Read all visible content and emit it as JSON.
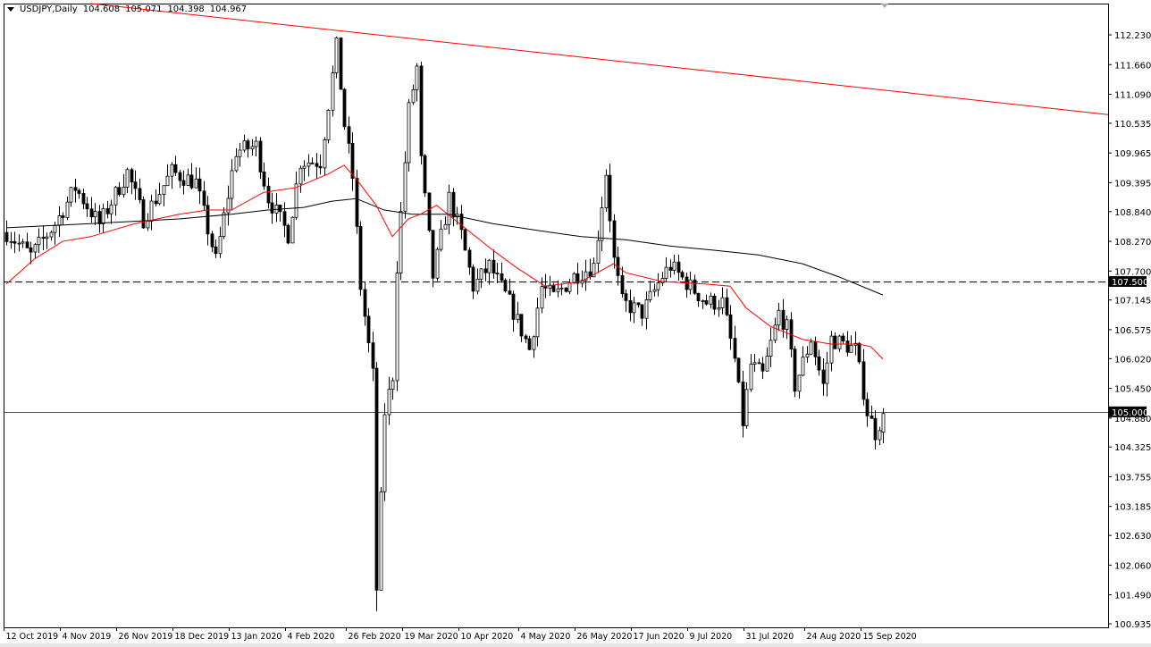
{
  "header": {
    "symbol": "USDJPY,Daily",
    "open": "104.608",
    "high": "105.071",
    "low": "104.398",
    "close": "104.967"
  },
  "chart_data": {
    "type": "candlestick",
    "title": "USDJPY,Daily",
    "ylim": [
      100.935,
      112.23
    ],
    "y_ticks": [
      "112.230",
      "111.660",
      "111.090",
      "110.535",
      "109.965",
      "109.395",
      "108.840",
      "108.270",
      "107.700",
      "107.145",
      "106.575",
      "106.020",
      "105.450",
      "104.880",
      "104.325",
      "103.755",
      "103.185",
      "102.630",
      "102.060",
      "101.490",
      "100.935"
    ],
    "x_ticks": [
      {
        "bar": 0,
        "label": "12 Oct 2019"
      },
      {
        "bar": 14,
        "label": "4 Nov 2019"
      },
      {
        "bar": 28,
        "label": "26 Nov 2019"
      },
      {
        "bar": 42,
        "label": "18 Dec 2019"
      },
      {
        "bar": 56,
        "label": "13 Jan 2020"
      },
      {
        "bar": 70,
        "label": "4 Feb 2020"
      },
      {
        "bar": 85,
        "label": "26 Feb 2020"
      },
      {
        "bar": 99,
        "label": "19 Mar 2020"
      },
      {
        "bar": 113,
        "label": "10 Apr 2020"
      },
      {
        "bar": 128,
        "label": "4 May 2020"
      },
      {
        "bar": 142,
        "label": "26 May 2020"
      },
      {
        "bar": 156,
        "label": "17 Jun 2020"
      },
      {
        "bar": 170,
        "label": "9 Jul 2020"
      },
      {
        "bar": 184,
        "label": "31 Jul 2020"
      },
      {
        "bar": 199,
        "label": "24 Aug 2020"
      },
      {
        "bar": 213,
        "label": "15 Sep 2020"
      }
    ],
    "bars_visible": 275,
    "close_path": [
      [
        0,
        108.44
      ],
      [
        6,
        108.0
      ],
      [
        12,
        108.6
      ],
      [
        17,
        109.3
      ],
      [
        23,
        108.6
      ],
      [
        30,
        109.6
      ],
      [
        34,
        108.7
      ],
      [
        41,
        109.6
      ],
      [
        47,
        109.4
      ],
      [
        52,
        107.9
      ],
      [
        57,
        110.0
      ],
      [
        62,
        110.1
      ],
      [
        65,
        109.1
      ],
      [
        70,
        108.4
      ],
      [
        73,
        109.8
      ],
      [
        78,
        109.8
      ],
      [
        82,
        112.0
      ],
      [
        84,
        110.5
      ],
      [
        86,
        109.5
      ],
      [
        88,
        107.4
      ],
      [
        91,
        105.7
      ],
      [
        92,
        101.6
      ],
      [
        94,
        105.0
      ],
      [
        96,
        105.7
      ],
      [
        97,
        107.8
      ],
      [
        100,
        110.8
      ],
      [
        102,
        111.6
      ],
      [
        103,
        109.8
      ],
      [
        106,
        107.6
      ],
      [
        110,
        109.1
      ],
      [
        113,
        108.4
      ],
      [
        116,
        107.4
      ],
      [
        120,
        107.8
      ],
      [
        125,
        107.1
      ],
      [
        130,
        106.2
      ],
      [
        133,
        107.4
      ],
      [
        136,
        107.2
      ],
      [
        141,
        107.6
      ],
      [
        146,
        107.8
      ],
      [
        149,
        109.6
      ],
      [
        151,
        107.9
      ],
      [
        153,
        107.1
      ],
      [
        158,
        106.9
      ],
      [
        163,
        107.6
      ],
      [
        165,
        107.8
      ],
      [
        170,
        107.4
      ],
      [
        174,
        107.1
      ],
      [
        178,
        107.1
      ],
      [
        181,
        106.0
      ],
      [
        183,
        104.8
      ],
      [
        185,
        105.9
      ],
      [
        188,
        105.7
      ],
      [
        192,
        106.9
      ],
      [
        194,
        106.6
      ],
      [
        196,
        105.5
      ],
      [
        200,
        106.4
      ],
      [
        203,
        105.5
      ],
      [
        205,
        106.4
      ],
      [
        211,
        106.2
      ],
      [
        214,
        105.0
      ],
      [
        216,
        104.6
      ],
      [
        218,
        104.967
      ]
    ],
    "ma_fast": [
      [
        0,
        107.45
      ],
      [
        7,
        107.93
      ],
      [
        14,
        108.27
      ],
      [
        21,
        108.36
      ],
      [
        32,
        108.61
      ],
      [
        43,
        108.79
      ],
      [
        50,
        108.87
      ],
      [
        56,
        108.87
      ],
      [
        64,
        109.21
      ],
      [
        72,
        109.3
      ],
      [
        80,
        109.56
      ],
      [
        84,
        109.73
      ],
      [
        87,
        109.47
      ],
      [
        92,
        108.96
      ],
      [
        96,
        108.36
      ],
      [
        100,
        108.7
      ],
      [
        103,
        108.79
      ],
      [
        107,
        108.96
      ],
      [
        114,
        108.53
      ],
      [
        121,
        108.1
      ],
      [
        127,
        107.76
      ],
      [
        134,
        107.41
      ],
      [
        143,
        107.5
      ],
      [
        147,
        107.67
      ],
      [
        151,
        107.84
      ],
      [
        154,
        107.67
      ],
      [
        163,
        107.5
      ],
      [
        174,
        107.45
      ],
      [
        180,
        107.41
      ],
      [
        184,
        106.99
      ],
      [
        190,
        106.64
      ],
      [
        198,
        106.39
      ],
      [
        205,
        106.3
      ],
      [
        212,
        106.3
      ],
      [
        215,
        106.25
      ],
      [
        218,
        106.01
      ]
    ],
    "ma_slow": [
      [
        0,
        108.53
      ],
      [
        21,
        108.61
      ],
      [
        43,
        108.7
      ],
      [
        56,
        108.79
      ],
      [
        65,
        108.87
      ],
      [
        74,
        108.92
      ],
      [
        81,
        109.04
      ],
      [
        87,
        109.09
      ],
      [
        94,
        108.87
      ],
      [
        101,
        108.79
      ],
      [
        110,
        108.79
      ],
      [
        121,
        108.61
      ],
      [
        132,
        108.48
      ],
      [
        143,
        108.36
      ],
      [
        154,
        108.3
      ],
      [
        165,
        108.18
      ],
      [
        176,
        108.1
      ],
      [
        187,
        108.01
      ],
      [
        198,
        107.84
      ],
      [
        207,
        107.59
      ],
      [
        218,
        107.24
      ]
    ],
    "trendline": [
      [
        21,
        112.83
      ],
      [
        274,
        110.7
      ]
    ],
    "levels": [
      {
        "price": 107.5,
        "label": "107.500",
        "style": "dashed"
      },
      {
        "price": 105.0,
        "label": "105.000",
        "style": "solid"
      }
    ],
    "colors": {
      "ma_fast": "#ff0000",
      "ma_slow": "#000000",
      "trendline": "#ff0000",
      "axis_text": "#000000"
    }
  }
}
